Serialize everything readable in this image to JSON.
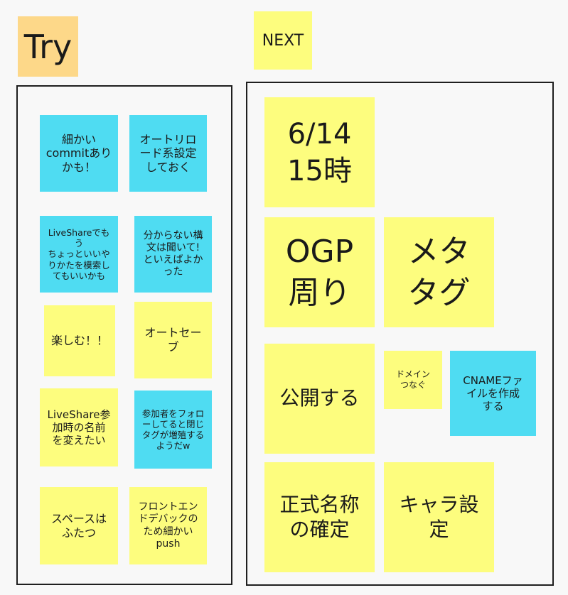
{
  "colors": {
    "yellow": "#fdfd7e",
    "blue": "#4fdcf2",
    "orange": "#fdd889"
  },
  "sections": {
    "try": {
      "title": "Try",
      "notes": [
        {
          "text": "細かい\ncommitあり\nかも！"
        },
        {
          "text": "オートリロ\nード系設定\nしておく"
        },
        {
          "text": "LiveShareでもう\nちょっといいや\nりかたを模索し\nてもいいかも"
        },
        {
          "text": "分からない構\n文は聞いて!\nといえばよか\nった"
        },
        {
          "text": "楽しむ！！"
        },
        {
          "text": "オートセー\nブ"
        },
        {
          "text": "LiveShare参\n加時の名前\nを変えたい"
        },
        {
          "text": "参加者をフォロ\nーしてると閉じ\nタグが増殖する\nようだw"
        },
        {
          "text": "スペースは\nふたつ"
        },
        {
          "text": "フロントエン\nドデバックの\nため細かい\npush"
        }
      ]
    },
    "next": {
      "title": "NEXT",
      "notes": [
        {
          "text": "6/14\n15時"
        },
        {
          "text": "OGP\n周り"
        },
        {
          "text": "メタ\nタグ"
        },
        {
          "text": "公開する"
        },
        {
          "text": "ドメイン\nつなぐ"
        },
        {
          "text": "CNAMEファ\nイルを作成\nする"
        },
        {
          "text": "正式名称\nの確定"
        },
        {
          "text": "キャラ設\n定"
        }
      ]
    }
  }
}
